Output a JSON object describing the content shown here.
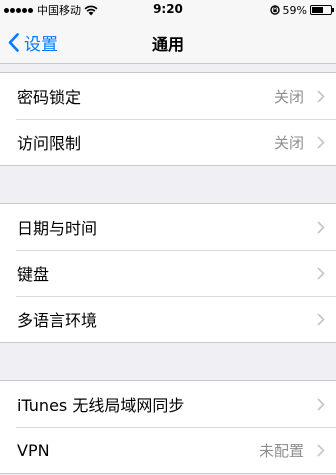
{
  "status_bar": {
    "carrier": "中国移动",
    "time": "9:20",
    "battery_percent": "59%",
    "battery_level": 0.59,
    "signal_bars": 5,
    "icons": [
      "signal-dots-icon",
      "wifi-icon",
      "rotation-lock-icon",
      "battery-icon"
    ]
  },
  "nav": {
    "back_label": "设置",
    "title": "通用"
  },
  "groups": [
    {
      "rows": [
        {
          "label": "密码锁定",
          "value": "关闭"
        },
        {
          "label": "访问限制",
          "value": "关闭"
        }
      ]
    },
    {
      "rows": [
        {
          "label": "日期与时间",
          "value": ""
        },
        {
          "label": "键盘",
          "value": ""
        },
        {
          "label": "多语言环境",
          "value": ""
        }
      ]
    },
    {
      "rows": [
        {
          "label": "iTunes 无线局域网同步",
          "value": ""
        },
        {
          "label": "VPN",
          "value": "未配置"
        }
      ]
    }
  ],
  "colors": {
    "accent": "#007aff",
    "background": "#efeff4",
    "secondary_text": "#8e8e93",
    "chevron": "#c7c7cc"
  }
}
